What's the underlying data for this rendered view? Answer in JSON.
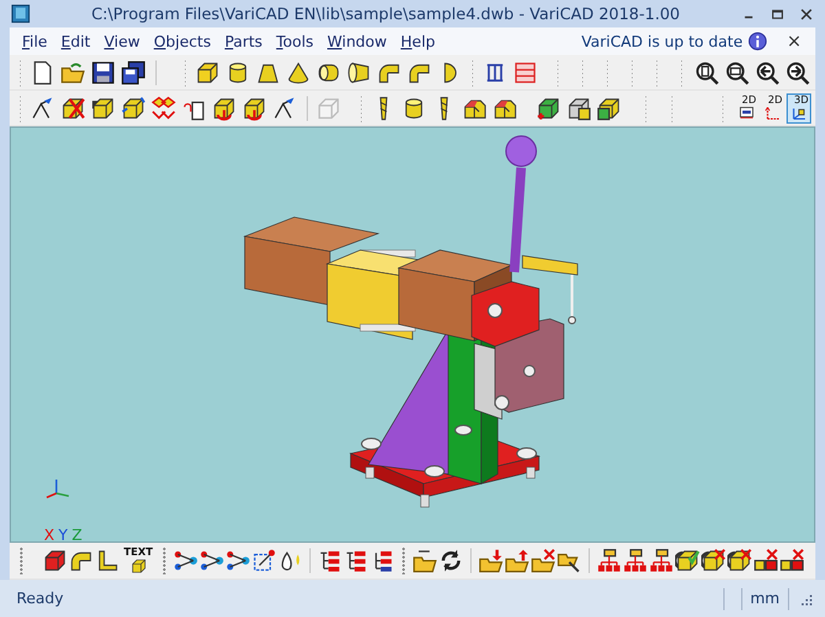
{
  "window": {
    "title": "C:\\Program Files\\VariCAD EN\\lib\\sample\\sample4.dwb - VariCAD 2018-1.00"
  },
  "menu": [
    {
      "label": "File"
    },
    {
      "label": "Edit"
    },
    {
      "label": "View"
    },
    {
      "label": "Objects"
    },
    {
      "label": "Parts"
    },
    {
      "label": "Tools"
    },
    {
      "label": "Window"
    },
    {
      "label": "Help"
    }
  ],
  "update_notice": {
    "text": "VariCAD is up to date",
    "close": "×"
  },
  "view_modes": [
    {
      "label": "2D",
      "selected": false
    },
    {
      "label": "2D",
      "selected": false
    },
    {
      "label": "3D",
      "selected": true
    }
  ],
  "text_tool": {
    "label": "TEXT"
  },
  "axes": {
    "x": "X",
    "y": "Y",
    "z": "Z"
  },
  "status_bar": {
    "message": "Ready",
    "units": "mm"
  }
}
